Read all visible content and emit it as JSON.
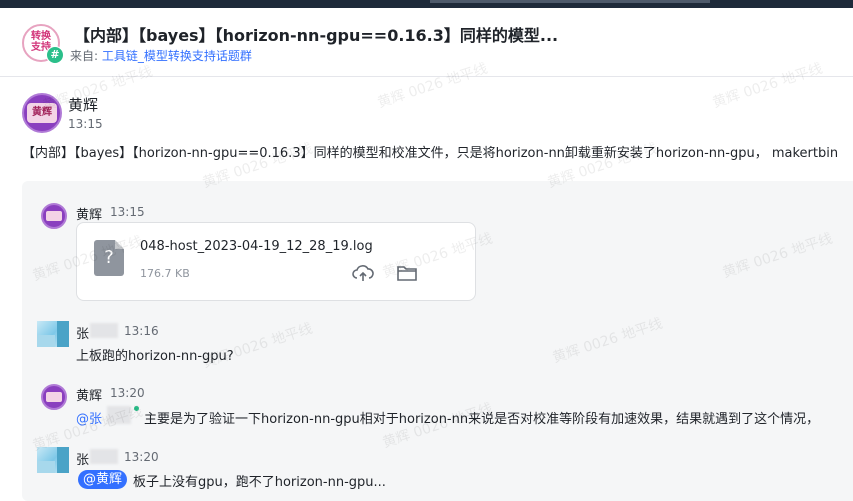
{
  "header": {
    "group_avatar_text": "转换支持",
    "group_avatar_badge": "#",
    "title": "【内部】【bayes】【horizon-nn-gpu==0.16.3】同样的模型...",
    "source_prefix": "来自: ",
    "source_link": "工具链_模型转换支持话题群"
  },
  "message": {
    "avatar_text": "黄辉",
    "sender": "黄辉",
    "time": "13:15",
    "text": "【内部】【bayes】【horizon-nn-gpu==0.16.3】同样的模型和校准文件，只是将horizon-nn卸载重新安装了horizon-nn-gpu， makertbin"
  },
  "thread": {
    "items": [
      {
        "sender": "黄辉",
        "time": "13:15"
      },
      {
        "sender": "张",
        "time": "13:16",
        "text": "上板跑的horizon-nn-gpu?"
      },
      {
        "sender": "黄辉",
        "time": "13:20",
        "mention": "@张",
        "text": "主要是为了验证一下horizon-nn-gpu相对于horizon-nn来说是否对校准等阶段有加速效果，结果就遇到了这个情况，"
      },
      {
        "sender": "张",
        "time": "13:20",
        "mention": "@黄辉",
        "text": "板子上没有gpu，跑不了horizon-nn-gpu..."
      }
    ],
    "file": {
      "icon_glyph": "?",
      "name": "048-host_2023-04-19_12_28_19.log",
      "size": "176.7 KB",
      "actions": [
        "cloud-upload-icon",
        "folder-icon"
      ]
    }
  },
  "watermark": "黄辉 0026 地平线"
}
